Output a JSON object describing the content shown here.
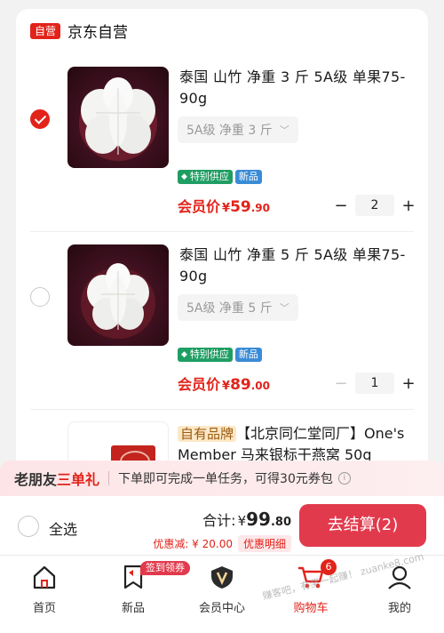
{
  "shop": {
    "badge": "自营",
    "name": "京东自营"
  },
  "items": [
    {
      "title": "泰国 山竹 净重 3 斤 5A级 单果75-90g",
      "spec": "5A级 净重 3 斤",
      "selected": true,
      "tags": {
        "special": "特别供应",
        "new": "新品"
      },
      "price_label": "会员价",
      "currency": "¥",
      "price_int": "59",
      "price_dec": ".90",
      "qty": "2",
      "minus": "−",
      "plus": "+"
    },
    {
      "title": "泰国 山竹 净重 5 斤 5A级 单果75-90g",
      "spec": "5A级 净重 5 斤",
      "selected": false,
      "tags": {
        "special": "特别供应",
        "new": "新品"
      },
      "price_label": "会员价",
      "currency": "¥",
      "price_int": "89",
      "price_dec": ".00",
      "qty": "1",
      "minus": "−",
      "plus": "+"
    },
    {
      "brand_tag": "自有品牌",
      "title": "【北京同仁堂同厂】One's Member 马来银标干燕窝 50g"
    }
  ],
  "promo": {
    "title_a": "老朋友",
    "title_b": "三单礼",
    "text": "下单即可完成一单任务，可得30元券包",
    "info": "i"
  },
  "checkout": {
    "select_all": "全选",
    "total_label": "合计:",
    "currency": "¥",
    "total_int": "99",
    "total_dec": ".80",
    "discount": "优惠减: ¥ 20.00",
    "discount_detail": "优惠明细",
    "pay_button": "去结算(2)"
  },
  "tabbar": {
    "tabs": [
      {
        "label": "首页",
        "icon": "home-icon"
      },
      {
        "label": "新品",
        "icon": "bookmark-icon"
      },
      {
        "label": "会员中心",
        "icon": "vip-icon"
      },
      {
        "label": "购物车",
        "icon": "cart-icon",
        "active": true
      },
      {
        "label": "我的",
        "icon": "user-icon"
      }
    ],
    "signin_badge": "签到领券",
    "cart_count": "6"
  },
  "watermark": "赚客吧，有奖一起赚！ zuanke8.com",
  "colors": {
    "accent": "#e2231a",
    "pay": "#e23a4d",
    "tag_green": "#1f9e63",
    "tag_blue": "#3a8bd6"
  }
}
